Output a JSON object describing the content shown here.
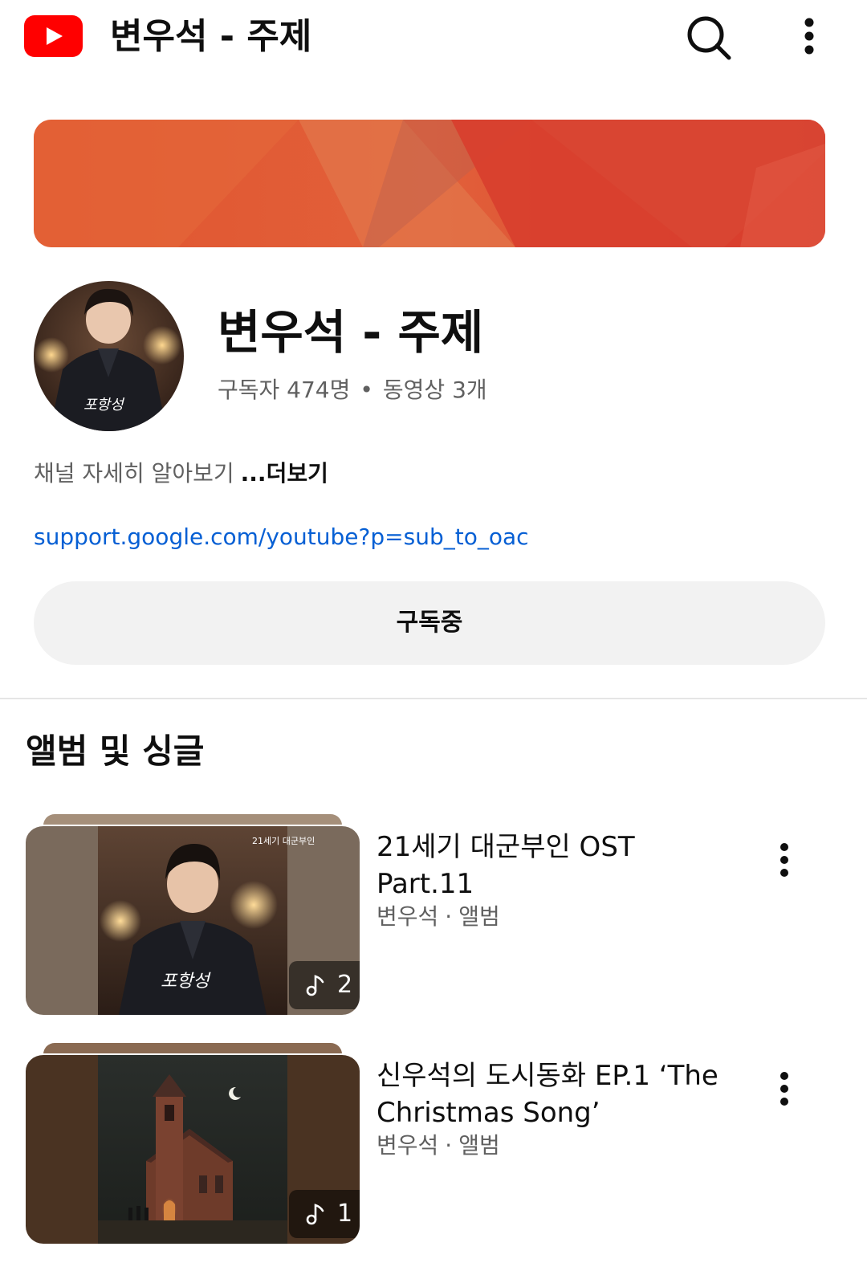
{
  "header": {
    "title": "변우석 - 주제",
    "logo_icon": "youtube-logo-icon",
    "search_icon": "search-icon",
    "more_icon": "more-vert-icon"
  },
  "channel": {
    "name": "변우석 - 주제",
    "subscribers": "구독자 474명",
    "separator": "•",
    "videos": "동영상 3개",
    "description": "채널 자세히 알아보기",
    "more_label": "...더보기",
    "link": "support.google.com/youtube?p=sub_to_oac",
    "subscribe_label": "구독중",
    "avatar_caption": "포항성"
  },
  "section": {
    "title": "앨범 및 싱글"
  },
  "albums": [
    {
      "title": "21세기 대군부인 OST Part.11",
      "artist": "변우석",
      "sep": "·",
      "type": "앨범",
      "track_count": "2",
      "cover_caption": "포항성",
      "cover_corner_text": "21세기 대군부인"
    },
    {
      "title": "신우석의 도시동화 EP.1 ‘The Christmas Song’",
      "artist": "변우석",
      "sep": "·",
      "type": "앨범",
      "track_count": "1"
    }
  ],
  "colors": {
    "brand_red": "#ff0000",
    "link_blue": "#065fd4",
    "secondary_text": "#606060",
    "button_bg": "#f2f2f2",
    "banner_red": "#d8452e"
  }
}
